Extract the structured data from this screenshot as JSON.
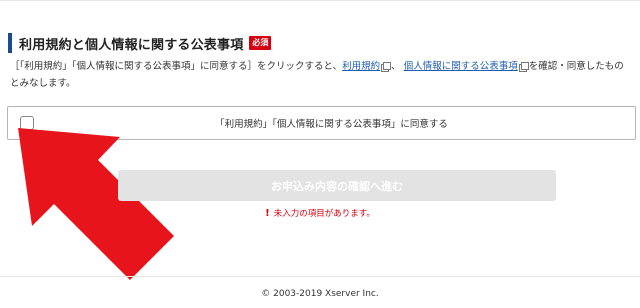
{
  "section": {
    "title": "利用規約と個人情報に関する公表事項",
    "required_badge": "必須"
  },
  "description": {
    "part1": "［「利用規約」「個人情報に関する公表事項」に同意する］をクリックすると、",
    "link_terms": "利用規約",
    "separator": "、",
    "link_privacy": "個人情報に関する公表事項",
    "part2": "を確認・同意したものとみなします。"
  },
  "agreement": {
    "label": "「利用規約」「個人情報に関する公表事項」に同意する",
    "checked": false
  },
  "submit": {
    "label": "お申込み内容の確認へ進む",
    "disabled": true
  },
  "error": {
    "icon": "!",
    "message": "未入力の項目があります。"
  },
  "footer": {
    "copyright": "© 2003-2019 Xserver Inc."
  },
  "colors": {
    "accent": "#1b4b8f",
    "required": "#d7000f",
    "link": "#1f5fb3",
    "annotation_arrow": "#e8141c",
    "button_disabled": "#e3e3e3"
  }
}
